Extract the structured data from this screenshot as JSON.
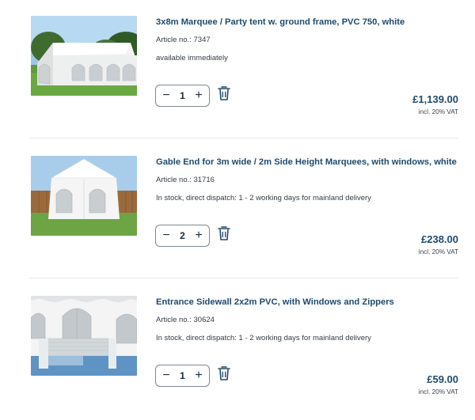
{
  "cart": {
    "items": [
      {
        "title": "3x8m Marquee / Party tent w. ground frame, PVC 750, white",
        "article": "Article no.: 7347",
        "availability": "available immediately",
        "quantity": "1",
        "price": "£1,139.00",
        "vat_note": "incl. 20% VAT",
        "image_icon": "marquee-photo"
      },
      {
        "title": "Gable End for 3m wide / 2m Side Height Marquees, with windows, white",
        "article": "Article no.: 31716",
        "availability": "In stock, direct dispatch: 1 - 2 working days for mainland delivery",
        "quantity": "2",
        "price": "£238.00",
        "vat_note": "incl. 20% VAT",
        "image_icon": "gable-end-photo"
      },
      {
        "title": "Entrance Sidewall 2x2m PVC, with Windows and Zippers",
        "article": "Article no.: 30624",
        "availability": "In stock, direct dispatch: 1 - 2 working days for mainland delivery",
        "quantity": "1",
        "price": "£59.00",
        "vat_note": "incl. 20% VAT",
        "image_icon": "sidewall-photo"
      }
    ],
    "controls": {
      "decrement": "−",
      "increment": "+",
      "remove_icon": "trash-icon"
    },
    "colors": {
      "title": "#1e4a6e",
      "text": "#333d47",
      "border": "#7d8892",
      "divider": "#e3e6ea"
    }
  }
}
